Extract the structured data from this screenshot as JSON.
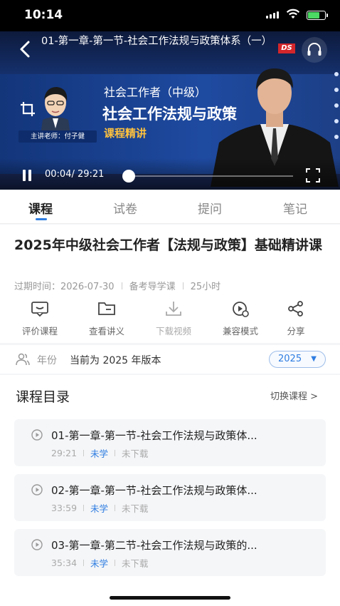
{
  "status_bar": {
    "time": "10:14"
  },
  "video": {
    "title": "01-第一章-第一节-社会工作法规与政策体系（一）",
    "logo_text": "DS",
    "teacher_tag": "主讲老师：付子健",
    "cert_text": "社会工作者（中级）",
    "subject_text": "社会工作法规与政策",
    "course_tag": "课程精讲",
    "timecode": "00:04/ 29:21",
    "progress": 0.003
  },
  "tabs": [
    {
      "label": "课程",
      "active": true
    },
    {
      "label": "试卷",
      "active": false
    },
    {
      "label": "提问",
      "active": false
    },
    {
      "label": "笔记",
      "active": false
    }
  ],
  "course": {
    "title": "2025年中级社会工作者【法规与政策】基础精讲课",
    "expire": "过期时间：2026-07-30",
    "type": "备考导学课",
    "hours": "25小时"
  },
  "actions": [
    {
      "label": "评价课程",
      "icon": "comment-icon"
    },
    {
      "label": "查看讲义",
      "icon": "folder-icon"
    },
    {
      "label": "下载视频",
      "icon": "download-icon"
    },
    {
      "label": "兼容模式",
      "icon": "compat-mode-icon"
    },
    {
      "label": "分享",
      "icon": "share-icon"
    }
  ],
  "year": {
    "label": "年份",
    "current_text": "当前为 2025 年版本",
    "selected": "2025"
  },
  "catalog": {
    "title": "课程目录",
    "switch_label": "切换课程 >",
    "lessons": [
      {
        "title": "01-第一章-第一节-社会工作法规与政策体...",
        "duration": "29:21",
        "study_status": "未学",
        "download_status": "未下载"
      },
      {
        "title": "02-第一章-第一节-社会工作法规与政策体...",
        "duration": "33:59",
        "study_status": "未学",
        "download_status": "未下载"
      },
      {
        "title": "03-第一章-第二节-社会工作法规与政策的...",
        "duration": "35:34",
        "study_status": "未学",
        "download_status": "未下载"
      }
    ]
  },
  "colors": {
    "accent": "#2f7de1",
    "video_bg": "#1e4aa0",
    "course_tag": "#ffc23e"
  }
}
